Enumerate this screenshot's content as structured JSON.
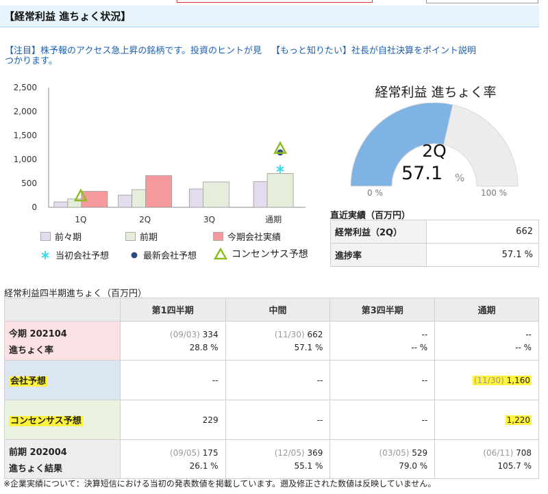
{
  "section_title": "【経常利益 進ちょく状況】",
  "links": [
    "【注目】株予報のアクセス急上昇の銘柄です。投資のヒントが見つかります。",
    "【もっと知りたい】社長が自社決算をポイント説明"
  ],
  "chart_data": {
    "type": "bar",
    "categories": [
      "1Q",
      "2Q",
      "3Q",
      "通期"
    ],
    "ylim": [
      0,
      2500
    ],
    "yticks": [
      "0",
      "500",
      "1,000",
      "1,500",
      "2,000",
      "2,500"
    ],
    "series": [
      {
        "name": "前々期",
        "color": "#e4dcee",
        "values": [
          114,
          255,
          384,
          538
        ]
      },
      {
        "name": "前期",
        "color": "#e4eedb",
        "values": [
          175,
          369,
          529,
          708
        ]
      },
      {
        "name": "今期会社実績",
        "color": "#f5999d",
        "values": [
          334,
          662,
          null,
          null
        ]
      }
    ],
    "markers": [
      {
        "name": "当初会社予想",
        "color": "#3ed9e8",
        "symbol": "asterisk",
        "points": [
          {
            "category": "通期",
            "value": 800
          }
        ]
      },
      {
        "name": "最新会社予想",
        "color": "#2d4b7a",
        "symbol": "dot",
        "points": [
          {
            "category": "通期",
            "value": 1160
          }
        ]
      },
      {
        "name": "コンセンサス予想",
        "color": "#8dbb22",
        "symbol": "triangle",
        "points": [
          {
            "category": "1Q",
            "value": 229
          },
          {
            "category": "通期",
            "value": 1220
          }
        ]
      }
    ],
    "legend_position": "bottom"
  },
  "gauge": {
    "title": "経常利益 進ちょく率",
    "quarter": "2Q",
    "value": "57.1",
    "unit": "%",
    "fraction": 0.571,
    "fill_color": "#7fb3e4",
    "track_color": "#ececec",
    "min_label": "0 %",
    "max_label": "100 %"
  },
  "recent": {
    "title": "直近実績（百万円）",
    "rows": [
      {
        "label": "経常利益（2Q）",
        "value": "662"
      },
      {
        "label": "進捗率",
        "value": "57.1 %"
      }
    ]
  },
  "progress_table": {
    "title": "経常利益四半期進ちょく（百万円）",
    "headers": [
      "",
      "第1四半期",
      "中間",
      "第3四半期",
      "通期"
    ],
    "rows": [
      {
        "label1": "今期 202104",
        "label2": "進ちょく率",
        "cells": [
          {
            "date": "(09/03)",
            "value": "334",
            "rate": "28.8 %"
          },
          {
            "date": "(11/30)",
            "value": "662",
            "rate": "57.1 %"
          },
          {
            "date": "",
            "value": "--",
            "rate": "-- %"
          },
          {
            "date": "",
            "value": "--",
            "rate": "-- %"
          }
        ]
      },
      {
        "label1": "会社予想",
        "cells": [
          {
            "date": "",
            "value": "--"
          },
          {
            "date": "",
            "value": "--"
          },
          {
            "date": "",
            "value": "--"
          },
          {
            "date": "(11/30)",
            "value": "1,160"
          }
        ]
      },
      {
        "label1": "コンセンサス予想",
        "cells": [
          {
            "date": "",
            "value": "229"
          },
          {
            "date": "",
            "value": "--"
          },
          {
            "date": "",
            "value": "--"
          },
          {
            "date": "",
            "value": "1,220"
          }
        ]
      },
      {
        "label1": "前期 202004",
        "label2": "進ちょく結果",
        "cells": [
          {
            "date": "(09/05)",
            "value": "175",
            "rate": "26.1 %"
          },
          {
            "date": "(12/05)",
            "value": "369",
            "rate": "55.1 %"
          },
          {
            "date": "(03/05)",
            "value": "529",
            "rate": "79.0 %"
          },
          {
            "date": "(06/11)",
            "value": "708",
            "rate": "105.7 %"
          }
        ]
      }
    ]
  },
  "footnote": "※企業実績について：決算短信における当初の発表数値を掲載しています。遡及修正された数値は反映していません。"
}
